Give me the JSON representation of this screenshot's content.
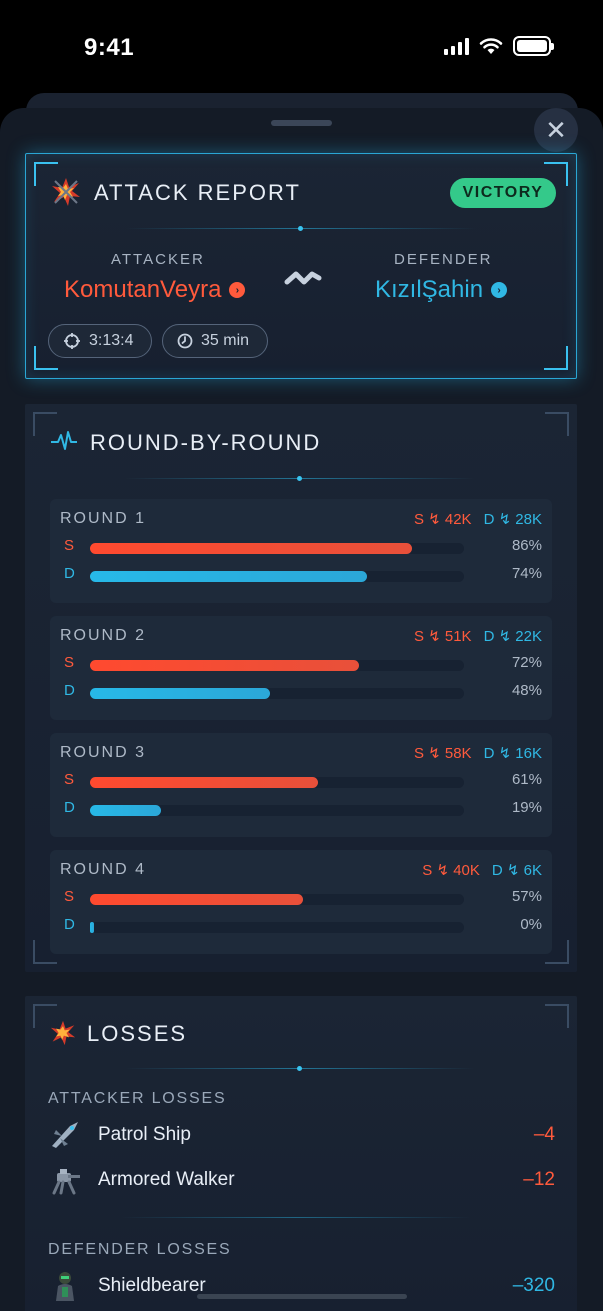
{
  "status_bar": {
    "time": "9:41",
    "battery_level": 1.0
  },
  "colors": {
    "attacker": "#ff5a3c",
    "defender": "#30b8e4",
    "victory": "#34c98a",
    "accent": "#2aa6d4"
  },
  "report": {
    "title": "ATTACK REPORT",
    "result": "VICTORY",
    "attacker_label": "ATTACKER",
    "attacker_name": "KomutanVeyra",
    "defender_label": "DEFENDER",
    "defender_name": "KızılŞahin",
    "coords": "3:13:4",
    "duration": "35 min",
    "icons": {
      "title": "explosion-icon",
      "coords": "crosshair-icon",
      "duration": "clock-icon",
      "versus": "zigzag-versus-icon"
    }
  },
  "rounds": {
    "title": "ROUND-BY-ROUND",
    "items": [
      {
        "label": "ROUND 1",
        "s_power": "S ↯ 42K",
        "d_power": "D ↯ 28K",
        "s_letter": "S",
        "d_letter": "D",
        "s_pct": "86%",
        "d_pct": "74%",
        "s_value": 86,
        "d_value": 74
      },
      {
        "label": "ROUND 2",
        "s_power": "S ↯ 51K",
        "d_power": "D ↯ 22K",
        "s_letter": "S",
        "d_letter": "D",
        "s_pct": "72%",
        "d_pct": "48%",
        "s_value": 72,
        "d_value": 48
      },
      {
        "label": "ROUND 3",
        "s_power": "S ↯ 58K",
        "d_power": "D ↯ 16K",
        "s_letter": "S",
        "d_letter": "D",
        "s_pct": "61%",
        "d_pct": "19%",
        "s_value": 61,
        "d_value": 19
      },
      {
        "label": "ROUND 4",
        "s_power": "S ↯ 40K",
        "d_power": "D ↯ 6K",
        "s_letter": "S",
        "d_letter": "D",
        "s_pct": "57%",
        "d_pct": "0%",
        "s_value": 57,
        "d_value": 0
      }
    ]
  },
  "losses": {
    "title": "LOSSES",
    "attacker_label": "ATTACKER LOSSES",
    "attacker": [
      {
        "name": "Patrol Ship",
        "value": "–4",
        "icon": "patrol-ship-icon"
      },
      {
        "name": "Armored Walker",
        "value": "–12",
        "icon": "armored-walker-icon"
      }
    ],
    "defender_label": "DEFENDER LOSSES",
    "defender": [
      {
        "name": "Shieldbearer",
        "value": "–320",
        "icon": "shieldbearer-icon"
      }
    ]
  },
  "close_label": "✕"
}
